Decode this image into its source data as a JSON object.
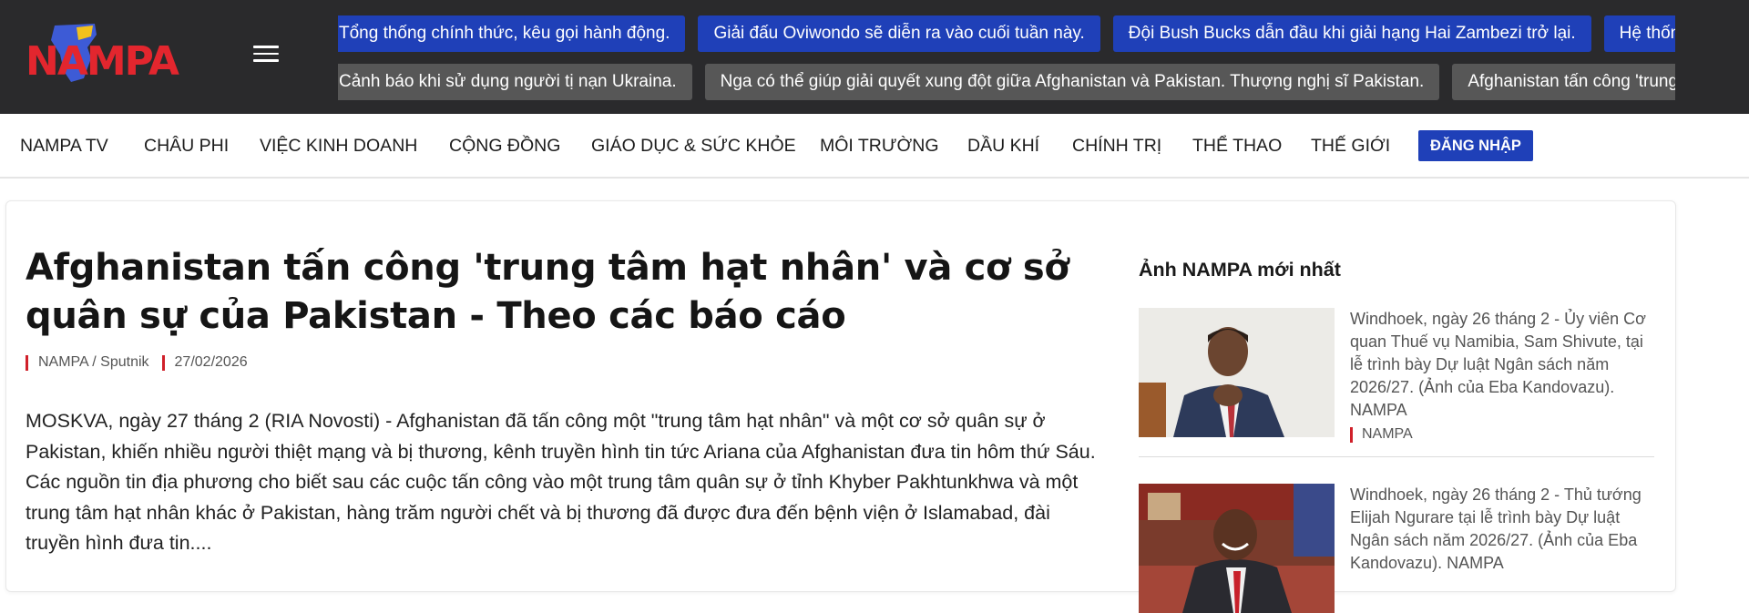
{
  "site": {
    "logo_text": "NAMPA",
    "colors": {
      "header_bg": "#2a2a2c",
      "accent_blue": "#1f40b8",
      "accent_red": "#d0202a",
      "ticker_gray": "#575757"
    }
  },
  "ticker_row1": [
    "Tổng thống chính thức, kêu gọi hành động.",
    "Giải đấu Oviwondo sẽ diễn ra vào cuối tuần này.",
    "Đội Bush Bucks dẫn đầu khi giải hạng Hai Zambezi trở lại.",
    "Hệ thống thanh toán mới được triển khai"
  ],
  "ticker_row2": [
    "Cảnh báo khi sử dụng người tị nạn Ukraina.",
    "Nga có thể giúp giải quyết xung đột giữa Afghanistan và Pakistan. Thượng nghị sĩ Pakistan.",
    "Afghanistan tấn công 'trung tâm hạt nhân' và cơ sở quân sự"
  ],
  "nav": {
    "items": [
      "NAMPA TV",
      "CHÂU PHI",
      "VIỆC KINH DOANH",
      "CỘNG ĐỒNG",
      "GIÁO DỤC & SỨC KHỎE",
      "MÔI TRƯỜNG",
      "DẦU KHÍ",
      "CHÍNH TRỊ",
      "THỂ THAO",
      "THẾ GIỚI"
    ],
    "login_label": "ĐĂNG NHẬP"
  },
  "article": {
    "title": "Afghanistan tấn công 'trung tâm hạt nhân' và cơ sở quân sự của Pakistan - Theo các báo cáo",
    "source": "NAMPA / Sputnik",
    "date": "27/02/2026",
    "excerpt": "MOSKVA, ngày 27 tháng 2 (RIA Novosti) - Afghanistan đã tấn công một \"trung tâm hạt nhân\" và một cơ sở quân sự ở Pakistan, khiến nhiều người thiệt mạng và bị thương, kênh truyền hình tin tức Ariana của Afghanistan đưa tin hôm thứ Sáu. Các nguồn tin địa phương cho biết sau các cuộc tấn công vào một trung tâm quân sự ở tỉnh Khyber Pakhtunkhwa và một trung tâm hạt nhân khác ở Pakistan, hàng trăm người chết và bị thương đã được đưa đến bệnh viện ở Islamabad, đài truyền hình đưa tin...."
  },
  "sidebar": {
    "title": "Ảnh NAMPA mới nhất",
    "photos": [
      {
        "caption": "Windhoek, ngày 26 tháng 2 - Ủy viên Cơ quan Thuế vụ Namibia, Sam Shivute, tại lễ trình bày Dự luật Ngân sách năm 2026/27. (Ảnh của Eba Kandovazu). NAMPA",
        "credit": "NAMPA"
      },
      {
        "caption": "Windhoek, ngày 26 tháng 2 - Thủ tướng Elijah Ngurare tại lễ trình bày Dự luật Ngân sách năm 2026/27. (Ảnh của Eba Kandovazu). NAMPA",
        "credit": ""
      }
    ]
  }
}
